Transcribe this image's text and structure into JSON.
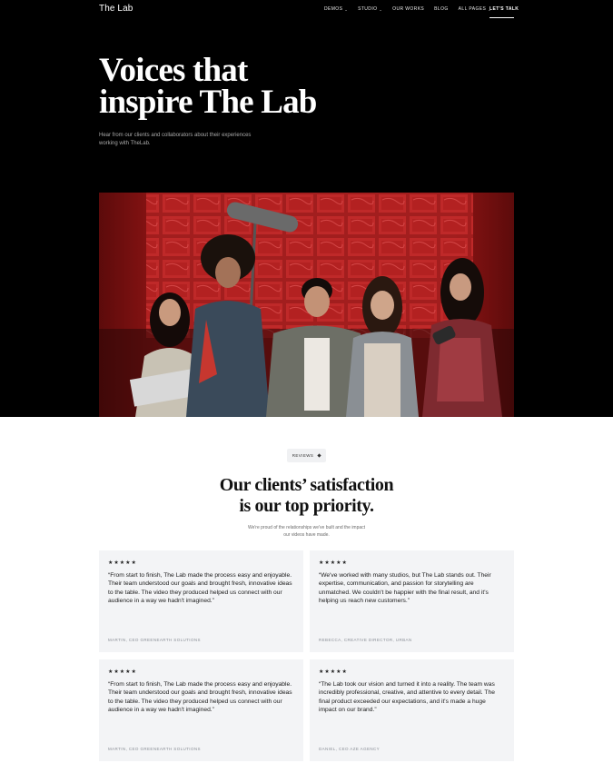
{
  "nav": {
    "logo": "The Lab",
    "items": [
      {
        "label": "DEMOS",
        "has_dropdown": true
      },
      {
        "label": "STUDIO",
        "has_dropdown": true
      },
      {
        "label": "OUR WORKS",
        "has_dropdown": false
      },
      {
        "label": "BLOG",
        "has_dropdown": false
      },
      {
        "label": "ALL PAGES",
        "has_dropdown": true
      }
    ],
    "cta": "LET'S TALK",
    "dropdown_glyph": "⌄"
  },
  "hero": {
    "title_line1": "Voices that",
    "title_line2": "inspire The Lab",
    "subtitle": "Hear from our clients and collaborators about their experiences working with TheLab."
  },
  "reviews": {
    "pill_label": "REVIEWS",
    "title_line1": "Our clients’ satisfaction",
    "title_line2": "is our top priority.",
    "subtitle": "We're proud of the relationships we've built and the impact our videos have made.",
    "cards": [
      {
        "stars": "★★★★★",
        "rating": 5,
        "quote": "“From start to finish, The Lab made the process easy and enjoyable. Their team understood our goals and brought fresh, innovative ideas to the table. The video they produced helped us connect with our audience in a way we hadn't imagined.”",
        "author": "MARTIN, CEO GREENEARTH SOLUTIONS"
      },
      {
        "stars": "★★★★★",
        "rating": 5,
        "quote": "“We've worked with many studios, but The Lab stands out. Their expertise, communication, and passion for storytelling are unmatched. We couldn't be happier with the final result, and it's helping us reach new customers.”",
        "author": "REBECCA, CREATIVE DIRECTOR, URBAN"
      },
      {
        "stars": "★★★★★",
        "rating": 5,
        "quote": "“From start to finish, The Lab made the process easy and enjoyable. Their team understood our goals and brought fresh, innovative ideas to the table. The video they produced helped us connect with our audience in a way we hadn't imagined.”",
        "author": "MARTIN, CEO GREENEARTH SOLUTIONS"
      },
      {
        "stars": "★★★★★",
        "rating": 5,
        "quote": "“The Lab took our vision and turned it into a reality. The team was incredibly professional, creative, and attentive to every detail. The final product exceeded our expectations, and it's made a huge impact on our brand.”",
        "author": "DANIEL, CEO AZE AGENCY"
      }
    ]
  },
  "colors": {
    "hero_bg": "#000000",
    "card_bg": "#f3f4f6",
    "photo_red": "#8e1414"
  }
}
